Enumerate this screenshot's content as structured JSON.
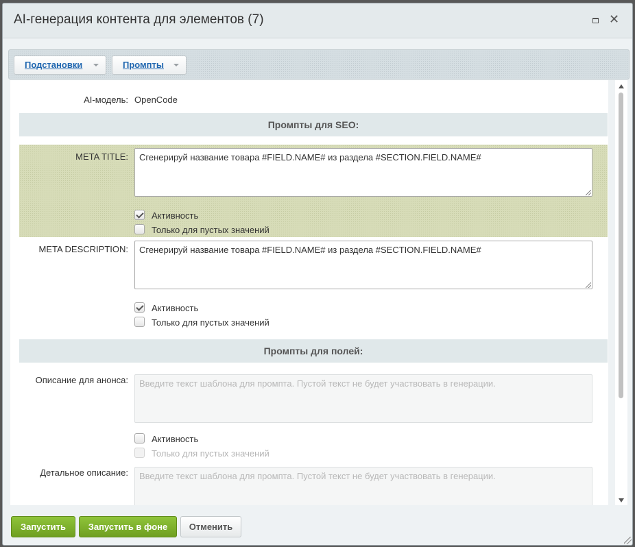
{
  "window": {
    "title": "AI-генерация контента для элементов (7)",
    "maximize_icon": "maximize-icon",
    "close_glyph": "✕"
  },
  "toolbar": {
    "substitutions_label": "Подстановки",
    "prompts_label": "Промпты"
  },
  "form": {
    "ai_model_label": "AI-модель:",
    "ai_model_value": "OpenCode",
    "seo_section_title": "Промпты для SEO:",
    "fields_section_title": "Промпты для полей:",
    "meta_title": {
      "label": "META TITLE:",
      "value": "Сгенерируй название товара #FIELD.NAME# из раздела #SECTION.FIELD.NAME#",
      "active_label": "Активность",
      "active_checked": true,
      "empty_only_label": "Только для пустых значений",
      "empty_only_checked": false
    },
    "meta_description": {
      "label": "META DESCRIPTION:",
      "value": "Сгенерируй название товара #FIELD.NAME# из раздела #SECTION.FIELD.NAME#",
      "active_label": "Активность",
      "active_checked": true,
      "empty_only_label": "Только для пустых значений",
      "empty_only_checked": false
    },
    "preview_text": {
      "label": "Описание для анонса:",
      "placeholder": "Введите текст шаблона для промпта. Пустой текст не будет участвовать в генерации.",
      "active_label": "Активность",
      "active_checked": false,
      "empty_only_label": "Только для пустых значений",
      "empty_only_disabled": true
    },
    "detail_text": {
      "label": "Детальное описание:",
      "placeholder": "Введите текст шаблона для промпта. Пустой текст не будет участвовать в генерации."
    }
  },
  "footer": {
    "run_label": "Запустить",
    "run_background_label": "Запустить в фоне",
    "cancel_label": "Отменить"
  },
  "colors": {
    "accent_green": "#7bb12c",
    "link_blue": "#2067b0",
    "highlight_row": "#d7dcb8"
  }
}
